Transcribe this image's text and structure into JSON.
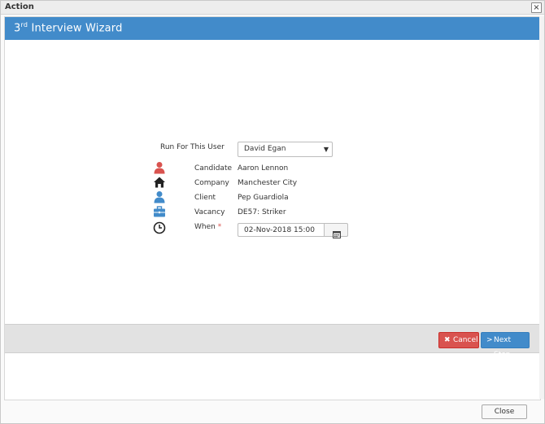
{
  "window": {
    "title": "Action"
  },
  "wizard": {
    "title_ordinal": "3",
    "title_suffix": "rd",
    "title_rest": " Interview Wizard"
  },
  "form": {
    "run_for_label": "Run For This User",
    "run_for_value": "David Egan",
    "candidate_label": "Candidate",
    "candidate_value": "Aaron Lennon",
    "company_label": "Company",
    "company_value": "Manchester City",
    "client_label": "Client",
    "client_value": "Pep Guardiola",
    "vacancy_label": "Vacancy",
    "vacancy_value": "DE57: Striker",
    "when_label": "When",
    "when_required": "*",
    "when_value": "02-Nov-2018 15:00"
  },
  "icons": {
    "candidate": "user-icon",
    "company": "home-icon",
    "client": "user-icon",
    "vacancy": "briefcase-icon",
    "when": "clock-icon",
    "calendar": "calendar-icon"
  },
  "buttons": {
    "cancel_glyph": "✖",
    "cancel": "Cancel",
    "next_glyph": ">",
    "next": "Next Step",
    "close": "Close"
  },
  "colors": {
    "header_blue": "#428bca",
    "cancel_red": "#d9534f",
    "candidate_icon": "#d9534f",
    "client_icon": "#428bca",
    "vacancy_icon": "#428bca"
  }
}
